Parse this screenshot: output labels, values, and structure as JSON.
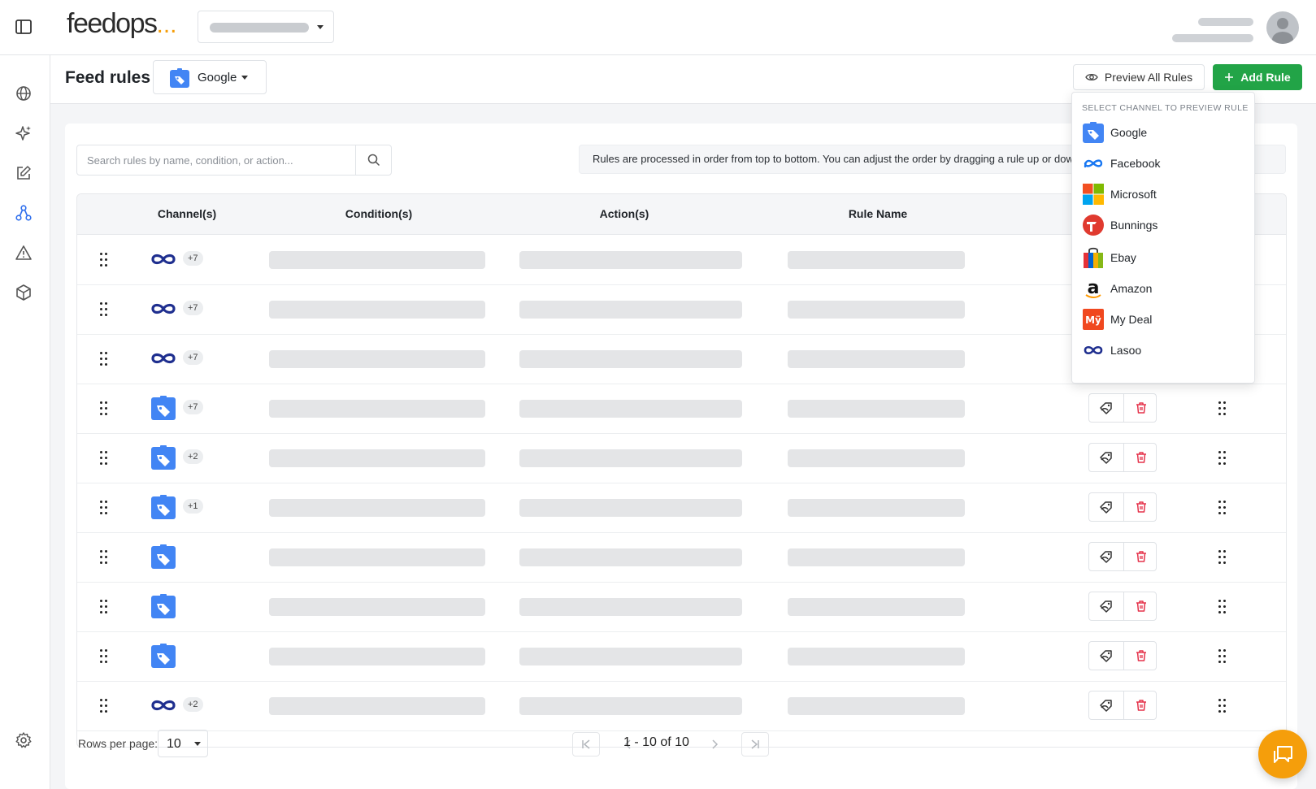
{
  "header": {
    "logo_text": "feedops",
    "logo_dots": "...",
    "store_selector": "",
    "user_name": ""
  },
  "page": {
    "title": "Feed rules",
    "channel_selected": "Google",
    "preview_button": "Preview All Rules",
    "add_button": "Add Rule"
  },
  "search": {
    "placeholder": "Search rules by name, condition, or action..."
  },
  "info_banner": "Rules are processed in order from top to bottom. You can adjust the order by dragging a rule up or down.",
  "table": {
    "columns": [
      "Channel(s)",
      "Condition(s)",
      "Action(s)",
      "Rule Name"
    ],
    "rows": [
      {
        "channel": "lasoo",
        "extra": "+7"
      },
      {
        "channel": "lasoo",
        "extra": "+7"
      },
      {
        "channel": "lasoo",
        "extra": "+7"
      },
      {
        "channel": "google",
        "extra": "+7"
      },
      {
        "channel": "google",
        "extra": "+2"
      },
      {
        "channel": "google",
        "extra": "+1"
      },
      {
        "channel": "google",
        "extra": ""
      },
      {
        "channel": "google",
        "extra": ""
      },
      {
        "channel": "google",
        "extra": ""
      },
      {
        "channel": "lasoo",
        "extra": "+2"
      }
    ]
  },
  "pagination": {
    "rows_per_page_label": "Rows per page:",
    "rows_per_page_value": "10",
    "range_text": "1 - 10 of 10"
  },
  "dropdown": {
    "header": "SELECT CHANNEL TO PREVIEW RULE",
    "items": [
      {
        "label": "Google",
        "icon": "google-shopping-icon"
      },
      {
        "label": "Facebook",
        "icon": "meta-icon"
      },
      {
        "label": "Microsoft",
        "icon": "microsoft-icon"
      },
      {
        "label": "Bunnings",
        "icon": "bunnings-icon"
      },
      {
        "label": "Ebay",
        "icon": "ebay-icon"
      },
      {
        "label": "Amazon",
        "icon": "amazon-icon"
      },
      {
        "label": "My Deal",
        "icon": "mydeal-icon"
      },
      {
        "label": "Lasoo",
        "icon": "lasoo-icon"
      }
    ]
  },
  "colors": {
    "accent_green": "#22a447",
    "delete_red": "#e5334b",
    "chat_orange": "#f59e0b",
    "lasoo_blue": "#1f2f8f",
    "google_blue": "#4285f4"
  }
}
